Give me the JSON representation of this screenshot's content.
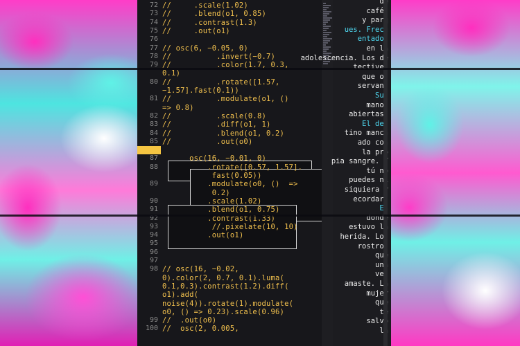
{
  "code_lines": [
    {
      "n": "72",
      "text": "//     .scale(1.02)"
    },
    {
      "n": "73",
      "text": "//     .blend(o1, 0.85)"
    },
    {
      "n": "74",
      "text": "//     .contrast(1.3)"
    },
    {
      "n": "75",
      "text": "//     .out(o1)"
    },
    {
      "n": "76",
      "text": ""
    },
    {
      "n": "77",
      "text": "// osc(6, −0.05, 0)"
    },
    {
      "n": "78",
      "text": "//          .invert(−0.7)"
    },
    {
      "n": "79",
      "text": "//          .color(1.7, 0.3,"
    },
    {
      "n": "",
      "text": "0.1)"
    },
    {
      "n": "80",
      "text": "//          .rotate([1.57,"
    },
    {
      "n": "",
      "text": "−1.57].fast(0.1))"
    },
    {
      "n": "81",
      "text": "//          .modulate(o1, ()"
    },
    {
      "n": "",
      "text": "=> 0.8)"
    },
    {
      "n": "82",
      "text": "//          .scale(0.8)"
    },
    {
      "n": "83",
      "text": "//          .diff(o1, 1)"
    },
    {
      "n": "84",
      "text": "//          .blend(o1, 0.2)"
    },
    {
      "n": "85",
      "text": "//          .out(o0)"
    },
    {
      "n": "86",
      "text": ""
    },
    {
      "n": "87",
      "text": "      osc(16, −0.01, 0)"
    },
    {
      "n": "88",
      "text": "          .rotate([0.57, 1.57]."
    },
    {
      "n": "",
      "text": "           fast(0.05))"
    },
    {
      "n": "89",
      "text": "          .modulate(o0, ()  =>"
    },
    {
      "n": "",
      "text": "           0.2)"
    },
    {
      "n": "90",
      "text": "          .scale(1.02)"
    },
    {
      "n": "91",
      "text": "          .blend(o1, 0.75)"
    },
    {
      "n": "92",
      "text": "          .contrast(1.33)"
    },
    {
      "n": "93",
      "text": "           //.pixelate(10, 10)"
    },
    {
      "n": "94",
      "text": "          .out(o1)"
    },
    {
      "n": "95",
      "text": ""
    },
    {
      "n": "96",
      "text": ""
    },
    {
      "n": "97",
      "text": ""
    },
    {
      "n": "98",
      "text": "// osc(16, −0.02,"
    },
    {
      "n": "",
      "text": "0).color(2, 0.7, 0.1).luma("
    },
    {
      "n": "",
      "text": "0.1,0.3).contrast(1.2).diff("
    },
    {
      "n": "",
      "text": "o1).add("
    },
    {
      "n": "",
      "text": "noise(4)).rotate(1).modulate("
    },
    {
      "n": "",
      "text": "o0, () => 0.23).scale(0.96)"
    },
    {
      "n": "99",
      "text": "//  .out(o0)"
    },
    {
      "n": "100",
      "text": "//  osc(2, 0.005,"
    }
  ],
  "aside_lines": [
    {
      "text": "de",
      "c": false
    },
    {
      "text": "cafés",
      "c": false
    },
    {
      "text": "y parq",
      "c": false
    },
    {
      "text": "ues. Frecu",
      "c": true
    },
    {
      "text": "entados",
      "c": true
    },
    {
      "text": "en la",
      "c": false
    },
    {
      "text": "adolescencia. Los de",
      "c": false
    },
    {
      "text": "tectives",
      "c": false
    },
    {
      "text": "que os",
      "c": false
    },
    {
      "text": "servan.",
      "c": false
    },
    {
      "text": "Sus",
      "c": true
    },
    {
      "text": "manos",
      "c": false
    },
    {
      "text": "abiertas.",
      "c": false
    },
    {
      "text": "El des",
      "c": true
    },
    {
      "text": "tino manch",
      "c": false
    },
    {
      "text": "ado con",
      "c": false
    },
    {
      "text": "la pro",
      "c": false
    },
    {
      "text": "pia sangre. Y",
      "c": false
    },
    {
      "text": "tú no",
      "c": false
    },
    {
      "text": "puedes ni",
      "c": false
    },
    {
      "text": "siquiera r",
      "c": false
    },
    {
      "text": "ecordar.",
      "c": false
    },
    {
      "text": "En",
      "c": true
    },
    {
      "text": "donde",
      "c": false
    },
    {
      "text": "estuvo la",
      "c": false
    },
    {
      "text": "herida. Los",
      "c": false
    },
    {
      "text": "rostros",
      "c": false
    },
    {
      "text": "que",
      "c": false
    },
    {
      "text": "una",
      "c": false
    },
    {
      "text": "vez",
      "c": false
    },
    {
      "text": "amaste. La",
      "c": false
    },
    {
      "text": "mujer",
      "c": false
    },
    {
      "text": "que",
      "c": false
    },
    {
      "text": "te",
      "c": false
    },
    {
      "text": "salvó",
      "c": false
    },
    {
      "text": "la",
      "c": false
    }
  ],
  "colors": {
    "code": "#f2c14e",
    "bg": "#17171b",
    "accent": "#4fd8f0",
    "highlight": "#f5c542"
  }
}
